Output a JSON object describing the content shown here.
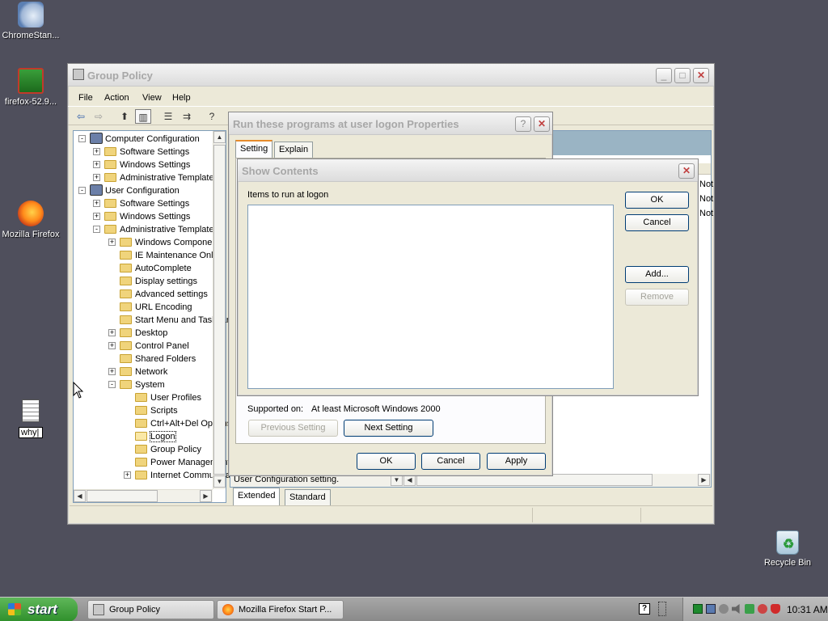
{
  "desktop": {
    "icons": [
      {
        "label": "ChromeStan..."
      },
      {
        "label": "firefox-52.9..."
      },
      {
        "label": "Mozilla Firefox"
      },
      {
        "label": "why|"
      },
      {
        "label": "Recycle Bin"
      }
    ]
  },
  "group_policy": {
    "title": "Group Policy",
    "menu": [
      "File",
      "Action",
      "View",
      "Help"
    ],
    "tree": [
      {
        "label": "Computer Configuration",
        "level": 0,
        "exp": "-",
        "icon": "computer"
      },
      {
        "label": "Software Settings",
        "level": 1,
        "exp": "+"
      },
      {
        "label": "Windows Settings",
        "level": 1,
        "exp": "+"
      },
      {
        "label": "Administrative Templates",
        "level": 1,
        "exp": "+"
      },
      {
        "label": "User Configuration",
        "level": 0,
        "exp": "-",
        "icon": "user"
      },
      {
        "label": "Software Settings",
        "level": 1,
        "exp": "+"
      },
      {
        "label": "Windows Settings",
        "level": 1,
        "exp": "+"
      },
      {
        "label": "Administrative Templates",
        "level": 1,
        "exp": "-"
      },
      {
        "label": "Windows Components",
        "level": 2,
        "exp": "+"
      },
      {
        "label": "IE Maintenance Only",
        "level": 2,
        "exp": ""
      },
      {
        "label": "AutoComplete",
        "level": 2,
        "exp": ""
      },
      {
        "label": "Display settings",
        "level": 2,
        "exp": ""
      },
      {
        "label": "Advanced settings",
        "level": 2,
        "exp": ""
      },
      {
        "label": "URL Encoding",
        "level": 2,
        "exp": ""
      },
      {
        "label": "Start Menu and Taskbar",
        "level": 2,
        "exp": ""
      },
      {
        "label": "Desktop",
        "level": 2,
        "exp": "+"
      },
      {
        "label": "Control Panel",
        "level": 2,
        "exp": "+"
      },
      {
        "label": "Shared Folders",
        "level": 2,
        "exp": ""
      },
      {
        "label": "Network",
        "level": 2,
        "exp": "+"
      },
      {
        "label": "System",
        "level": 2,
        "exp": "-"
      },
      {
        "label": "User Profiles",
        "level": 3,
        "exp": ""
      },
      {
        "label": "Scripts",
        "level": 3,
        "exp": ""
      },
      {
        "label": "Ctrl+Alt+Del Options",
        "level": 3,
        "exp": ""
      },
      {
        "label": "Logon",
        "level": 3,
        "exp": "",
        "selected": true
      },
      {
        "label": "Group Policy",
        "level": 3,
        "exp": ""
      },
      {
        "label": "Power Management",
        "level": 3,
        "exp": ""
      },
      {
        "label": "Internet Communication",
        "level": 3,
        "exp": "+"
      }
    ],
    "right_partial": [
      "Not",
      "Not",
      "Not"
    ],
    "bottom_tabs": [
      "Extended",
      "Standard"
    ],
    "right_text": "User Configuration setting."
  },
  "properties": {
    "title": "Run these programs at user logon Properties",
    "help_label": "?",
    "close_label": "✕",
    "tabs": [
      "Setting",
      "Explain"
    ],
    "supported_label": "Supported on:",
    "supported_value": "At least Microsoft Windows 2000",
    "prev_button": "Previous Setting",
    "next_button": "Next Setting",
    "ok": "OK",
    "cancel": "Cancel",
    "apply": "Apply"
  },
  "show_contents": {
    "title": "Show Contents",
    "list_label": "Items to run at logon",
    "ok": "OK",
    "cancel": "Cancel",
    "add": "Add...",
    "remove": "Remove",
    "close_label": "✕"
  },
  "taskbar": {
    "start": "start",
    "items": [
      "Group Policy",
      "Mozilla Firefox Start P..."
    ],
    "clock": "10:31 AM",
    "help_icon": "?"
  }
}
